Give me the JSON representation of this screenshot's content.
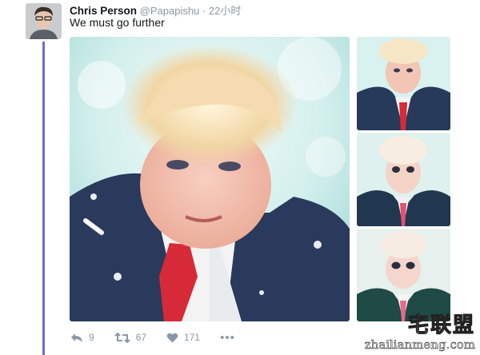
{
  "tweet": {
    "author_name": "Chris Person",
    "author_handle": "@Papapishu",
    "separator": "·",
    "time": "22小时",
    "text": "We must go further"
  },
  "actions": {
    "reply_count": "9",
    "retweet_count": "67",
    "like_count": "171",
    "more_label": "•••"
  },
  "icons": {
    "reply": "reply-icon",
    "retweet": "retweet-icon",
    "like": "heart-icon",
    "more": "more-icon"
  },
  "colors": {
    "thread_line": "#6e6ad6",
    "muted": "#8899a6",
    "text": "#14171a"
  },
  "watermark": {
    "logo": "宅联盟",
    "url": "zhailianmeng.com"
  }
}
